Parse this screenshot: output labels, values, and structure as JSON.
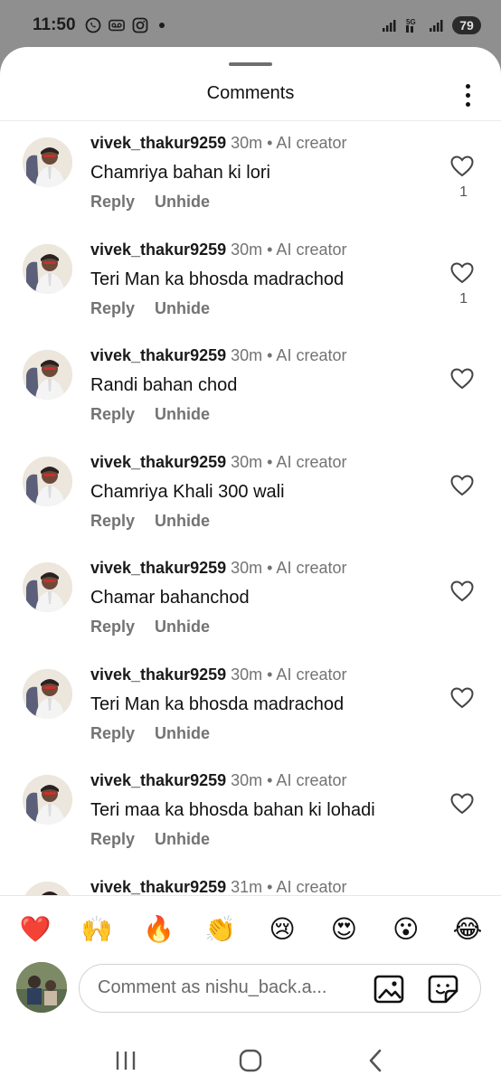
{
  "status_bar": {
    "time": "11:50",
    "battery": "79",
    "left_icons": [
      "whatsapp-icon",
      "voicemail-icon",
      "instagram-icon"
    ],
    "right_icons": [
      "signal-icon",
      "5g-icon",
      "signal-icon"
    ]
  },
  "sheet": {
    "title": "Comments"
  },
  "comments": [
    {
      "username": "vivek_thakur9259",
      "meta": " 30m • AI creator",
      "text": "Chamriya bahan ki lori",
      "reply": "Reply",
      "unhide": "Unhide",
      "likes": "1"
    },
    {
      "username": "vivek_thakur9259",
      "meta": " 30m • AI creator",
      "text": "Teri Man ka bhosda madrachod",
      "reply": "Reply",
      "unhide": "Unhide",
      "likes": "1"
    },
    {
      "username": "vivek_thakur9259",
      "meta": " 30m • AI creator",
      "text": "Randi bahan chod",
      "reply": "Reply",
      "unhide": "Unhide",
      "likes": ""
    },
    {
      "username": "vivek_thakur9259",
      "meta": " 30m • AI creator",
      "text": "Chamriya Khali 300 wali",
      "reply": "Reply",
      "unhide": "Unhide",
      "likes": ""
    },
    {
      "username": "vivek_thakur9259",
      "meta": " 30m • AI creator",
      "text": "Chamar bahanchod",
      "reply": "Reply",
      "unhide": "Unhide",
      "likes": ""
    },
    {
      "username": "vivek_thakur9259",
      "meta": " 30m • AI creator",
      "text": "Teri Man ka bhosda madrachod",
      "reply": "Reply",
      "unhide": "Unhide",
      "likes": ""
    },
    {
      "username": "vivek_thakur9259",
      "meta": " 30m • AI creator",
      "text": "Teri maa ka bhosda bahan ki lohadi",
      "reply": "Reply",
      "unhide": "Unhide",
      "likes": ""
    },
    {
      "username": "vivek_thakur9259",
      "meta": " 31m • AI creator",
      "text": "",
      "reply": "",
      "unhide": "",
      "likes": ""
    }
  ],
  "quick_reactions": [
    "❤️",
    "🙌",
    "🔥",
    "👏",
    "😢",
    "😍",
    "😮",
    "😂"
  ],
  "composer": {
    "placeholder": "Comment as nishu_back.a..."
  },
  "colors": {
    "meta_gray": "#737373",
    "status_bar_bg": "#8f8f8f"
  }
}
